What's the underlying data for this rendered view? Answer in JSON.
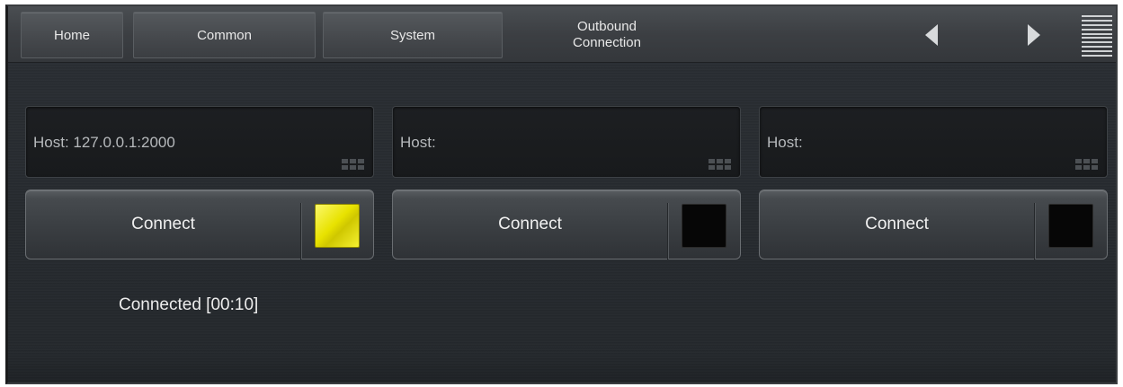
{
  "nav": {
    "home": "Home",
    "common": "Common",
    "system": "System",
    "current_line1": "Outbound",
    "current_line2": "Connection"
  },
  "icons": {
    "back": "triangle-left-icon",
    "forward": "triangle-right-icon",
    "menu": "hamburger-menu-icon",
    "keyboard": "keyboard-icon"
  },
  "hosts": [
    {
      "label": "Host: 127.0.0.1:2000"
    },
    {
      "label": "Host:"
    },
    {
      "label": "Host:"
    }
  ],
  "connections": [
    {
      "label": "Connect",
      "indicator": "on",
      "indicator_color": "#e8e200"
    },
    {
      "label": "Connect",
      "indicator": "off",
      "indicator_color": "#060606"
    },
    {
      "label": "Connect",
      "indicator": "off",
      "indicator_color": "#060606"
    }
  ],
  "status": {
    "text": "Connected [00:10]"
  }
}
